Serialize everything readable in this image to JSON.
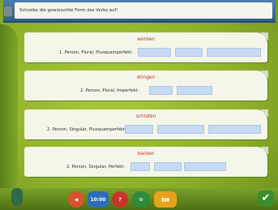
{
  "instruction": "Schreibe die gewünschte Form des Verbs auf!",
  "cards": [
    {
      "verb": "werden",
      "prompt": "1. Person, Plural, Plusquamperfekt:"
    },
    {
      "verb": "dringen",
      "prompt": "2. Person, Plural, Imperfekt:"
    },
    {
      "verb": "schlafen",
      "prompt": "2. Person, Singular, Plusquamperfekt:"
    },
    {
      "verb": "backen",
      "prompt": "2. Person, Singular, Perfekt:"
    }
  ],
  "toolbar": {
    "clock_text": "10:00"
  },
  "icons": {
    "back": "back-arrow-icon",
    "clock": "clock-icon",
    "help": "help-icon",
    "settings": "settings-icon",
    "stats": "stats-icon",
    "check": "check-icon",
    "flask": "flask-icon"
  }
}
